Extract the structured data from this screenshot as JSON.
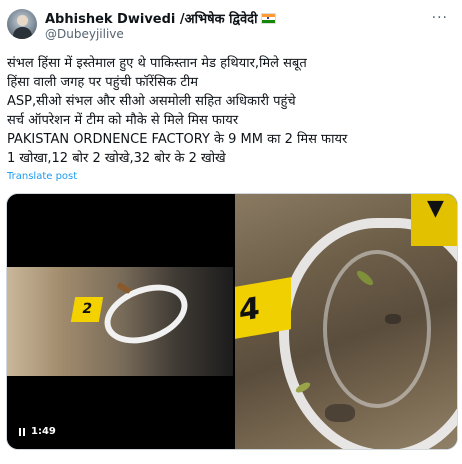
{
  "author": {
    "name": "Abhishek Dwivedi /अभिषेक द्विवेदी",
    "handle": "@Dubeyjilive",
    "flag_icon": "india-flag-icon"
  },
  "more_label": "···",
  "post": {
    "lines": [
      "संभल हिंसा में इस्तेमाल हुए थे पाकिस्तान मेड हथियार,मिले सबूत",
      "हिंसा वाली जगह पर पहुंची फॉरेंसिक टीम",
      "ASP,सीओ संभल और सीओ असमोली सहित अधिकारी पहुंचे",
      "सर्च ऑपरेशन में टीम को मौके से मिले मिस फायर",
      "PAKISTAN ORDNENCE FACTORY के 9 MM का 2 मिस फायर",
      " 1 खोखा,12 बोर 2 खोखे,32 बोर के 2 खोखे"
    ],
    "translate_label": "Translate post"
  },
  "media": {
    "video": {
      "duration": "1:49",
      "marker_label": "2"
    },
    "photo": {
      "marker_label": "4"
    }
  },
  "colors": {
    "link": "#1d9bf0",
    "secondary_text": "#536471",
    "marker_yellow": "#f3d200"
  }
}
